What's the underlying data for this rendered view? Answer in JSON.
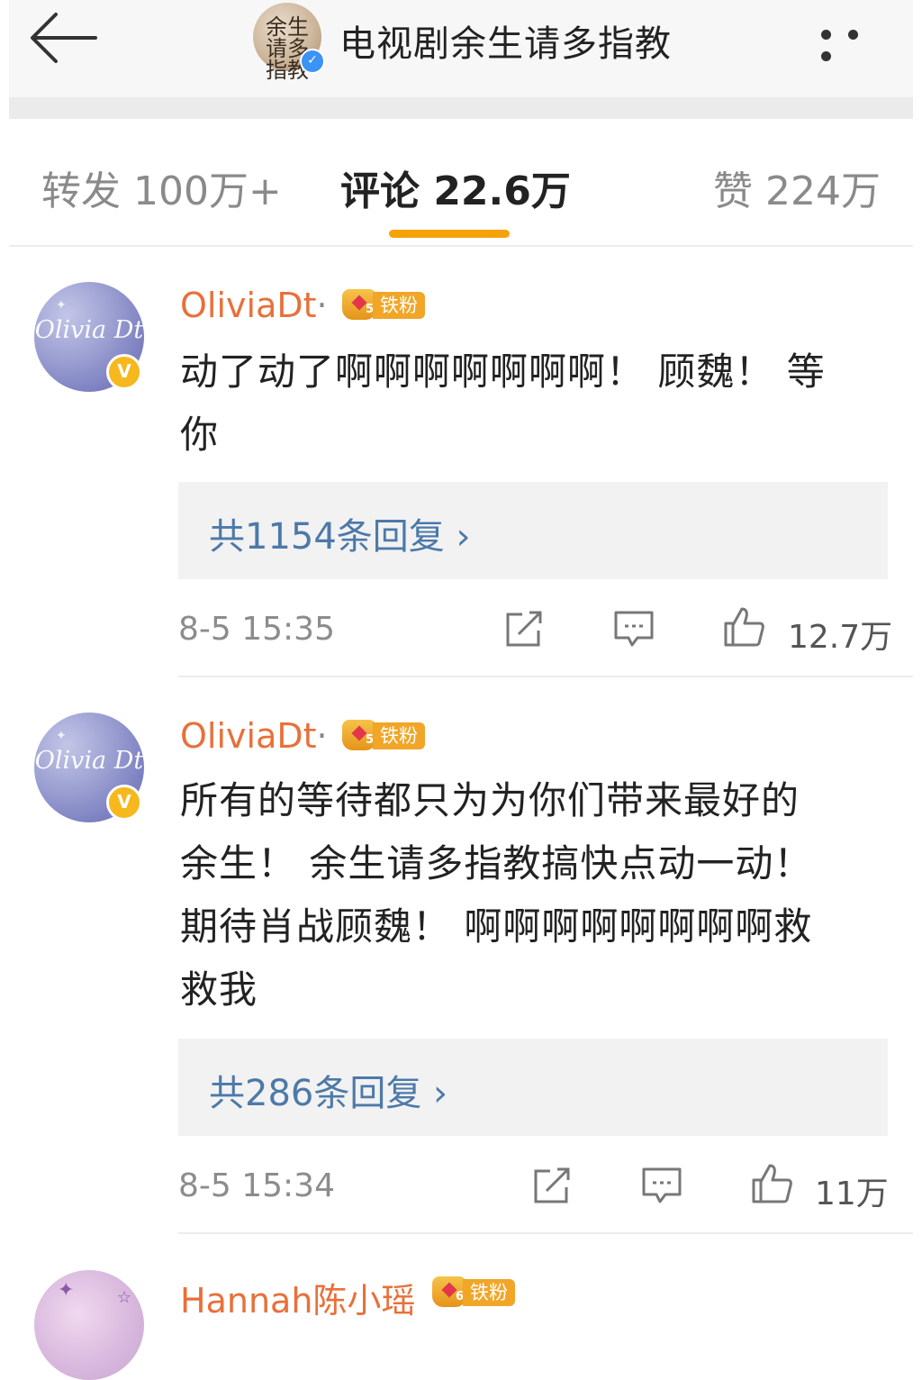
{
  "header": {
    "title": "电视剧余生请多指教",
    "avatar_text": "余生 请多指教"
  },
  "tabs": [
    {
      "label": "转发 100万+"
    },
    {
      "label": "评论 22.6万"
    },
    {
      "label": "赞 224万"
    }
  ],
  "comments": [
    {
      "username": "OliviaDt",
      "separator": "·",
      "fan_level": "5",
      "fan_tag": "铁粉",
      "avatar_text": "Olivia Dt",
      "text_lines": [
        "动了动了啊啊啊啊啊啊啊！ 顾魏！ 等",
        "你"
      ],
      "reply_label": "共1154条回复 ›",
      "time": "8-5 15:35",
      "likes": "12.7万"
    },
    {
      "username": "OliviaDt",
      "separator": "·",
      "fan_level": "5",
      "fan_tag": "铁粉",
      "avatar_text": "Olivia Dt",
      "text_lines": [
        "所有的等待都只为为你们带来最好的",
        "余生！ 余生请多指教搞快点动一动！",
        "期待肖战顾魏！ 啊啊啊啊啊啊啊啊救",
        "救我"
      ],
      "reply_label": "共286条回复 ›",
      "time": "8-5 15:34",
      "likes": "11万"
    },
    {
      "username": "Hannah陈小瑶",
      "fan_level": "6",
      "fan_tag": "铁粉"
    }
  ],
  "colors": {
    "accent_orange": "#f6a20b",
    "username": "#e8703a",
    "reply_link": "#4d79a9"
  }
}
